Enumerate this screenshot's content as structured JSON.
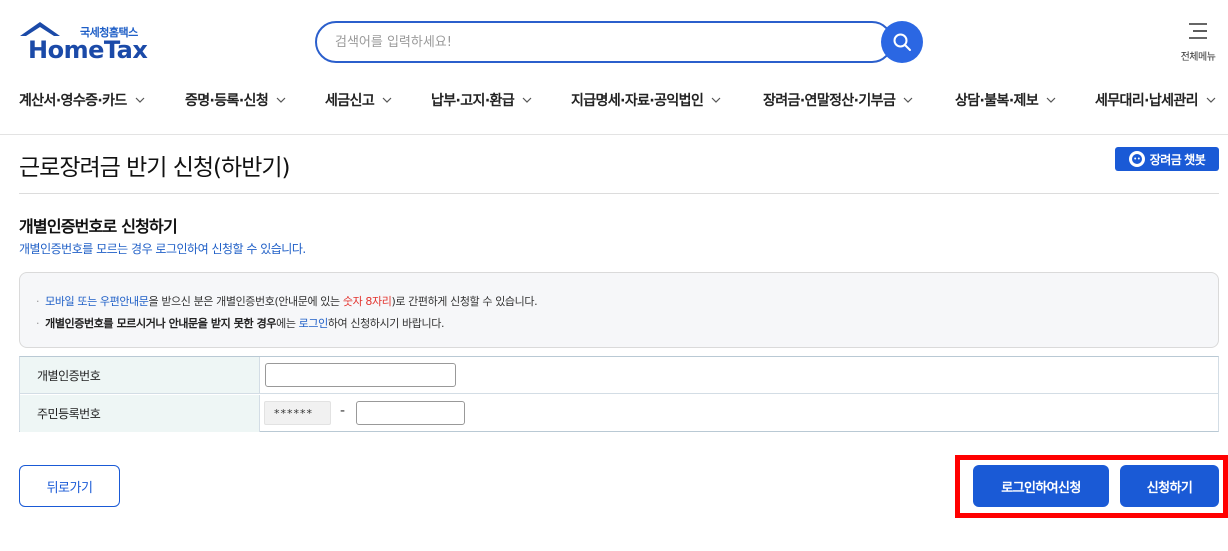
{
  "header": {
    "logo_kr": "국세청홈택스",
    "logo_en": "HomeTax",
    "search_placeholder": "검색어를 입력하세요!",
    "all_menu_label": "전체메뉴",
    "gnb": [
      {
        "label": "계산서·영수증·카드"
      },
      {
        "label": "증명·등록·신청"
      },
      {
        "label": "세금신고"
      },
      {
        "label": "납부·고지·환급"
      },
      {
        "label": "지급명세·자료·공익법인"
      },
      {
        "label": "장려금·연말정산·기부금"
      },
      {
        "label": "상담·불복·제보"
      },
      {
        "label": "세무대리·납세관리"
      }
    ]
  },
  "page": {
    "title": "근로장려금 반기 신청(하반기)",
    "chatbot_label": "장려금 챗봇",
    "section_title": "개별인증번호로 신청하기",
    "section_sub": "개별인증번호를 모르는 경우 로그인하여 신청할 수 있습니다.",
    "notice": {
      "line1": {
        "part1": "모바일 또는 우편안내문",
        "part2": "을 받으신 분은 개별인증번호(안내문에 있는 ",
        "part3": "숫자 8자리",
        "part4": ")로 간편하게 신청할 수 있습니다."
      },
      "line2": {
        "part1": "개별인증번호를 모르시거나 안내문을 받지 못한 경우",
        "part2": "에는 ",
        "part3": "로그인",
        "part4": "하여 신청하시기 바랍니다."
      }
    },
    "form": {
      "auth_label": "개별인증번호",
      "auth_value": "",
      "rrn_label": "주민등록번호",
      "rrn_front_masked": "******",
      "rrn_dash": "-",
      "rrn_back_value": ""
    },
    "buttons": {
      "back": "뒤로가기",
      "login_apply": "로그인하여신청",
      "apply": "신청하기"
    }
  },
  "colors": {
    "primary": "#1a5ad6",
    "highlight": "#ff0000",
    "table_header_bg": "#eef6f5"
  }
}
